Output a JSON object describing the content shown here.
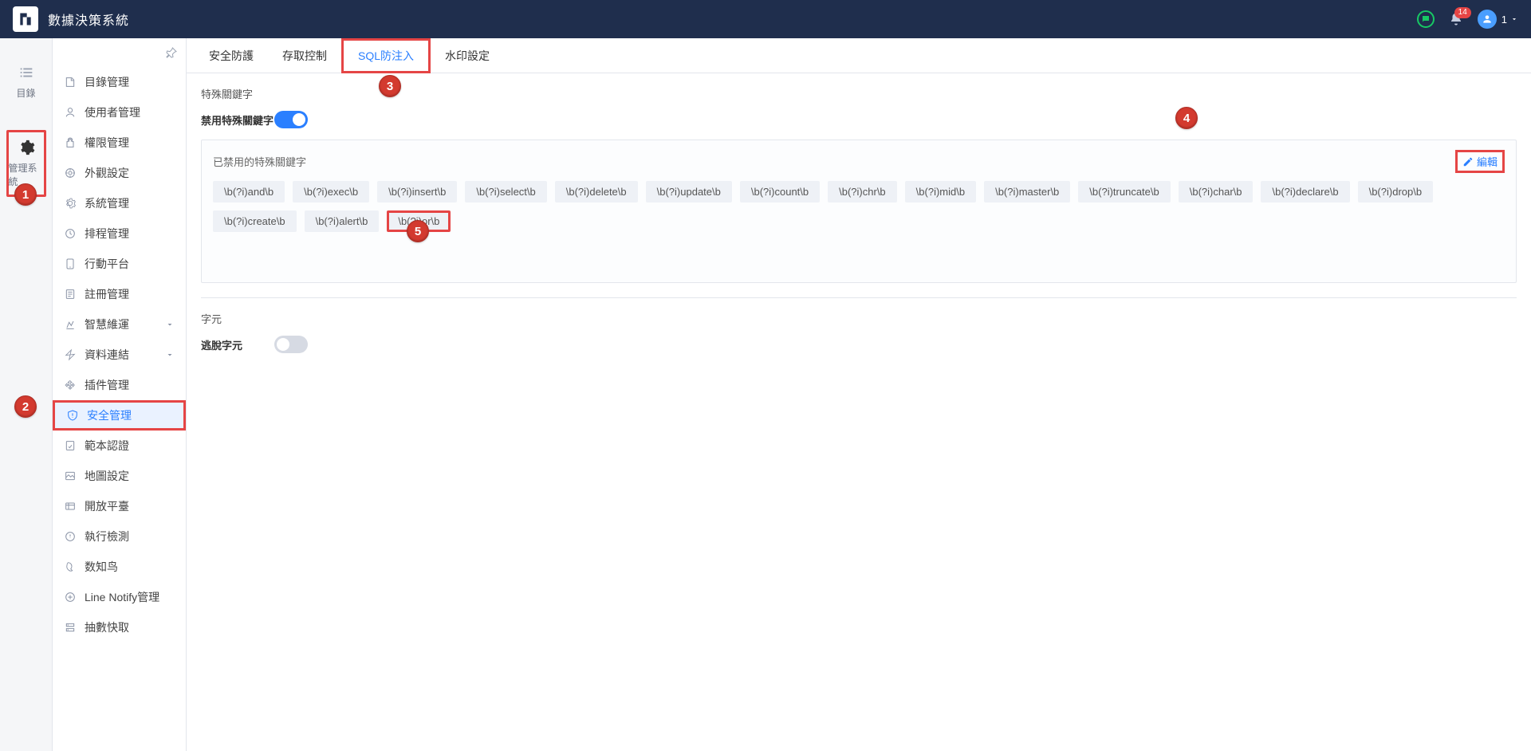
{
  "header": {
    "app_title": "數據決策系統",
    "notifications_count": "14",
    "user_count": "1"
  },
  "rail": {
    "items": [
      {
        "id": "catalog",
        "label": "目錄"
      },
      {
        "id": "manage",
        "label": "管理系統"
      }
    ]
  },
  "sidebar": {
    "items": [
      {
        "label": "目錄管理"
      },
      {
        "label": "使用者管理"
      },
      {
        "label": "權限管理"
      },
      {
        "label": "外觀設定"
      },
      {
        "label": "系統管理"
      },
      {
        "label": "排程管理"
      },
      {
        "label": "行動平台"
      },
      {
        "label": "註冊管理"
      },
      {
        "label": "智慧維運",
        "expandable": true
      },
      {
        "label": "資料連結",
        "expandable": true
      },
      {
        "label": "插件管理"
      },
      {
        "label": "安全管理",
        "active": true
      },
      {
        "label": "範本認證"
      },
      {
        "label": "地圖設定"
      },
      {
        "label": "開放平臺"
      },
      {
        "label": "執行檢測"
      },
      {
        "label": "数知鸟"
      },
      {
        "label": "Line Notify管理"
      },
      {
        "label": "抽數快取"
      }
    ]
  },
  "tabs": [
    {
      "label": "安全防護"
    },
    {
      "label": "存取控制"
    },
    {
      "label": "SQL防注入",
      "active": true
    },
    {
      "label": "水印設定"
    }
  ],
  "section1": {
    "title": "特殊關鍵字",
    "toggle_label": "禁用特殊關鍵字",
    "panel_title": "已禁用的特殊關鍵字",
    "edit_label": "編輯",
    "keywords": [
      "\\b(?i)and\\b",
      "\\b(?i)exec\\b",
      "\\b(?i)insert\\b",
      "\\b(?i)select\\b",
      "\\b(?i)delete\\b",
      "\\b(?i)update\\b",
      "\\b(?i)count\\b",
      "\\b(?i)chr\\b",
      "\\b(?i)mid\\b",
      "\\b(?i)master\\b",
      "\\b(?i)truncate\\b",
      "\\b(?i)char\\b",
      "\\b(?i)declare\\b",
      "\\b(?i)drop\\b",
      "\\b(?i)create\\b",
      "\\b(?i)alert\\b",
      "\\b(?i)or\\b"
    ]
  },
  "section2": {
    "title": "字元",
    "toggle_label": "逃脫字元"
  },
  "callouts": [
    "1",
    "2",
    "3",
    "4",
    "5"
  ]
}
